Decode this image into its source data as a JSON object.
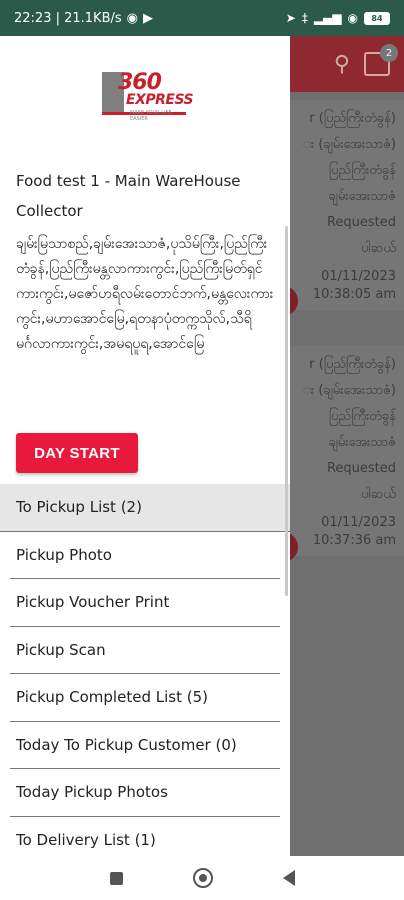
{
  "status_bar": {
    "time_speed": "22:23 | 21.1KB/s",
    "battery": "84"
  },
  "background": {
    "notification_count": "2",
    "cards": [
      {
        "lines": [
          "r (ပြည်ကြီးတံခွန်)",
          "း (ချမ်းအေးသာဇံ)",
          "ပြည်ကြီးတံခွန်",
          "ချမ်းအေးသာဇံ",
          "Requested",
          "ပါဆယ်"
        ],
        "date": "01/11/2023",
        "time": "10:38:05 am"
      },
      {
        "lines": [
          "r (ပြည်ကြီးတံခွန်)",
          "း (ချမ်းအေးသာဇံ)",
          "ပြည်ကြီးတံခွန်",
          "ချမ်းအေးသာဇံ",
          "Requested",
          "ပါဆယ်"
        ],
        "date": "01/11/2023",
        "time": "10:37:36 am"
      }
    ]
  },
  "drawer": {
    "logo": {
      "number": "360",
      "brand": "EXPRESS",
      "tagline": "MAKE YOUR LIFE EASIER"
    },
    "user_name": "Food test 1 - Main WareHouse",
    "role": "Collector",
    "address": "ချမ်းမြသာစည်,ချမ်းအေးသာဇံ,ပုသိမ်ကြီး,ပြည်ကြီးတံခွန်,ပြည်ကြီးမန္တလာကားကွင်း,ပြည်ကြီးမြတ်ရှင်ကားကွင်း,မဇော်ဟရီလမ်းတောင်ဘက်,မန္တလေးကားကွင်း,မဟာအောင်မြေ,ရတနာပုံတက္ကသိုလ်,သီရိမင်္ဂလာကားကွင်း,အမရပူရ,အောင်မြေ",
    "day_start_label": "DAY START",
    "menu": [
      {
        "label": "To Pickup List (2)",
        "active": true
      },
      {
        "label": "Pickup Photo",
        "active": false
      },
      {
        "label": "Pickup Voucher Print",
        "active": false
      },
      {
        "label": "Pickup Scan",
        "active": false
      },
      {
        "label": "Pickup Completed List (5)",
        "active": false
      },
      {
        "label": "Today To Pickup Customer (0)",
        "active": false
      },
      {
        "label": "Today Pickup Photos",
        "active": false
      },
      {
        "label": "To Delivery List (1)",
        "active": false
      }
    ]
  }
}
